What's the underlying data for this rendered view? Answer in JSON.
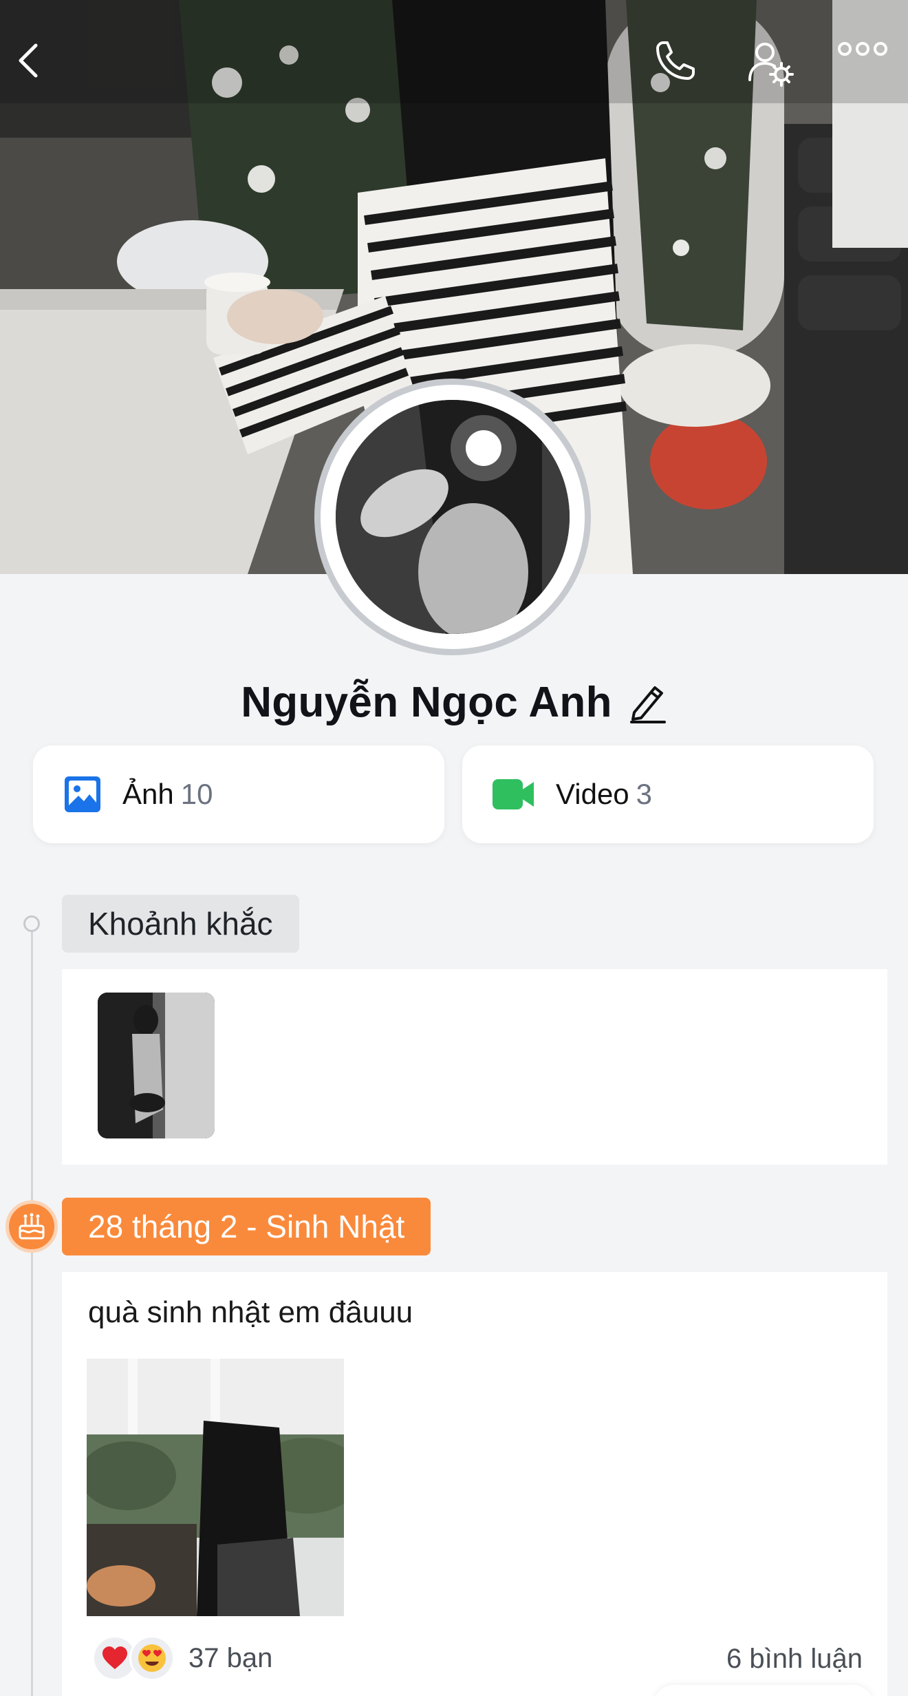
{
  "profile": {
    "name": "Nguyễn Ngọc Anh"
  },
  "media": {
    "photos_label": "Ảnh",
    "photos_count": "10",
    "videos_label": "Video",
    "videos_count": "3"
  },
  "timeline": {
    "moments_label": "Khoảnh khắc",
    "birthday_label": "28 tháng 2 - Sinh Nhật",
    "post_text": "quà sinh nhật em đâuuu",
    "friends_reacted": "37 bạn",
    "comments": "6 bình luận"
  },
  "colors": {
    "accent_orange": "#f98a3c",
    "photo_icon_blue": "#1a73e8",
    "video_icon_green": "#2fbf5f"
  },
  "icons": {
    "back": "chevron-left-icon",
    "call": "phone-icon",
    "settings": "user-gear-icon",
    "more": "more-horizontal-icon",
    "edit": "pencil-icon",
    "photo": "image-icon",
    "video": "video-camera-icon",
    "birthday": "cake-icon",
    "react_heart": "heart-icon",
    "react_love": "heart-eyes-icon"
  }
}
